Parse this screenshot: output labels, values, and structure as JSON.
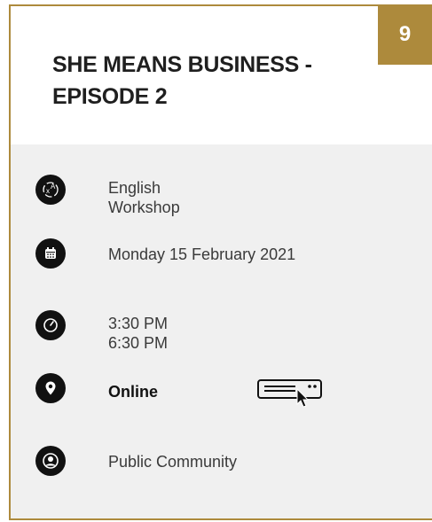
{
  "event": {
    "number": "9",
    "title": "SHE MEANS BUSINESS - EPISODE 2"
  },
  "details": {
    "language": "English",
    "format": "Workshop",
    "date": "Monday 15 February 2021",
    "start_time": "3:30 PM",
    "end_time": "6:30 PM",
    "location": "Online",
    "audience": "Public Community"
  },
  "icons": {
    "language": "translate-icon",
    "date": "calendar-icon",
    "time": "clock-icon",
    "location": "map-pin-icon",
    "online": "online-device-icon",
    "audience": "user-circle-icon"
  },
  "colors": {
    "accent": "#ad8a3c",
    "details_background": "#f0f0f0",
    "icon_background": "#111111"
  }
}
